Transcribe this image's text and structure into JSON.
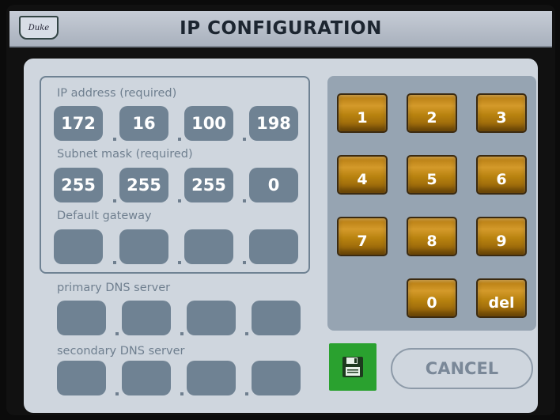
{
  "header": {
    "title": "IP CONFIGURATION",
    "logo_text": "Duke"
  },
  "network": {
    "ip_address": {
      "label": "IP address (required)",
      "octets": [
        "172",
        "16",
        "100",
        "198"
      ]
    },
    "subnet_mask": {
      "label": "Subnet mask (required)",
      "octets": [
        "255",
        "255",
        "255",
        "0"
      ]
    },
    "default_gateway": {
      "label": "Default gateway",
      "octets": [
        "",
        "",
        "",
        ""
      ]
    },
    "primary_dns": {
      "label": "primary DNS server",
      "octets": [
        "",
        "",
        "",
        ""
      ]
    },
    "secondary_dns": {
      "label": "secondary DNS server",
      "octets": [
        "",
        "",
        "",
        ""
      ]
    }
  },
  "keypad": {
    "keys": [
      "1",
      "2",
      "3",
      "4",
      "5",
      "6",
      "7",
      "8",
      "9",
      "0",
      "del"
    ]
  },
  "actions": {
    "save_icon": "floppy-disk-icon",
    "cancel_label": "CANCEL"
  },
  "colors": {
    "accent_key": "#c48a1c",
    "field_bg": "#6f8293",
    "save_green": "#2aa12f",
    "panel_bg": "#cfd6de"
  }
}
